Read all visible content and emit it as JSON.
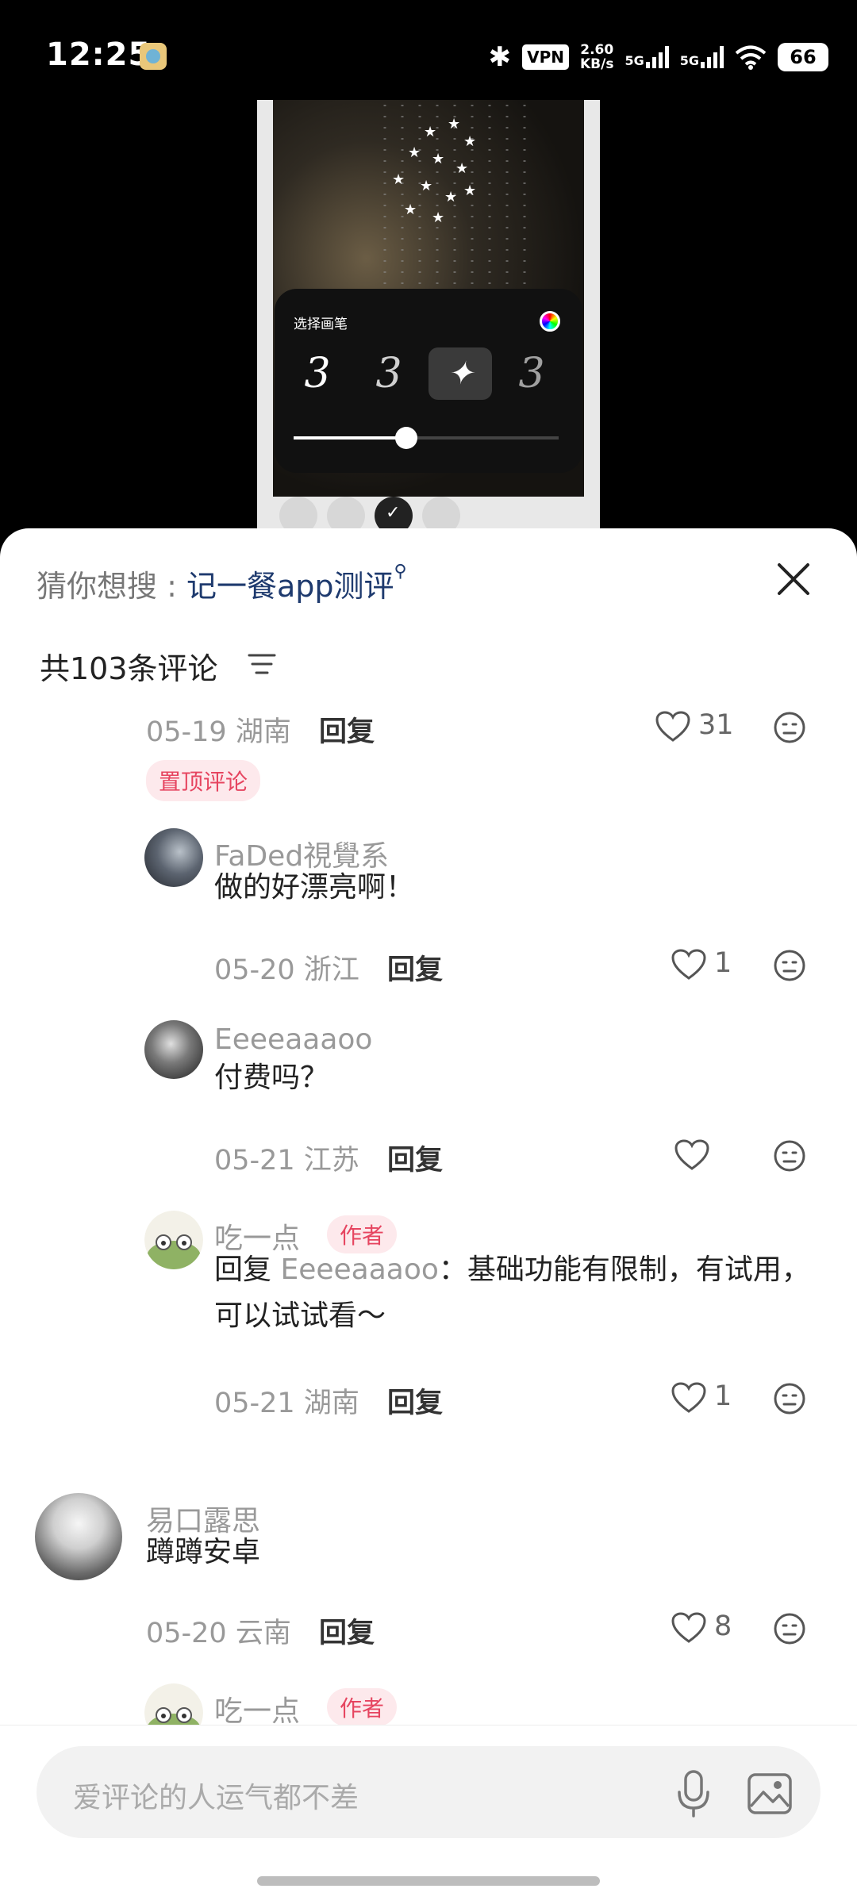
{
  "status_bar": {
    "time": "12:25",
    "vpn": "VPN",
    "speed_value": "2.60",
    "speed_unit": "KB/s",
    "net1": "5G",
    "net2": "5G",
    "battery": "66"
  },
  "preview": {
    "panel_title": "选择画笔"
  },
  "sheet": {
    "guess_label": "猜你想搜 : ",
    "guess_keyword": "记一餐app测评",
    "comment_count": "共103条评论",
    "comments": [
      {
        "meta": "05-19 湖南",
        "reply": "回复",
        "likes": "31",
        "pinned_tag": "置顶评论"
      },
      {
        "name": "FaDed視覺系",
        "text": "做的好漂亮啊！",
        "meta": "05-20 浙江",
        "reply": "回复",
        "likes": "1"
      },
      {
        "name": "Eeeeaaaoo",
        "text": "付费吗？",
        "meta": "05-21 江苏",
        "reply": "回复",
        "likes": ""
      },
      {
        "name": "吃一点",
        "author_tag": "作者",
        "reply_prefix": "回复 ",
        "reply_target": "Eeeeaaaoo",
        "text": "：基础功能有限制，有试用，可以试试看～",
        "meta": "05-21 湖南",
        "reply": "回复",
        "likes": "1"
      },
      {
        "name": "易口露思",
        "text": "蹲蹲安卓",
        "meta": "05-20 云南",
        "reply": "回复",
        "likes": "8"
      },
      {
        "name": "吃一点",
        "author_tag": "作者"
      }
    ],
    "input_placeholder": "爱评论的人运气都不差"
  },
  "colors": {
    "accent_pink": "#e64560",
    "keyword_blue": "#1e3a6e"
  }
}
